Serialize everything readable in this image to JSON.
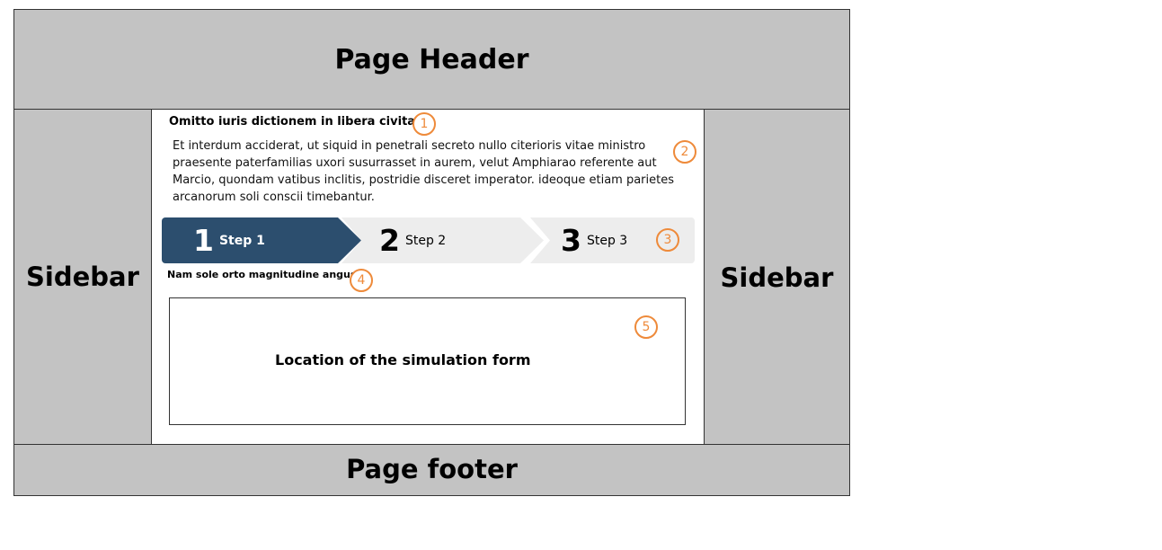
{
  "header": {
    "label": "Page Header"
  },
  "sidebar_left": {
    "label": "Sidebar"
  },
  "sidebar_right": {
    "label": "Sidebar"
  },
  "footer": {
    "label": "Page footer"
  },
  "main": {
    "title": "Omitto iuris dictionem in libera civitate",
    "paragraph": "Et interdum acciderat, ut siquid in penetrali secreto nullo citerioris vitae ministro praesente paterfamilias uxori susurrasset in aurem, velut Amphiarao referente aut Marcio, quondam vatibus inclitis, postridie disceret imperator. ideoque etiam parietes arcanorum soli conscii timebantur.",
    "steps": [
      {
        "number": "1",
        "label": "Step 1",
        "active": true
      },
      {
        "number": "2",
        "label": "Step 2",
        "active": false
      },
      {
        "number": "3",
        "label": "Step 3",
        "active": false
      }
    ],
    "subtitle": "Nam sole orto magnitudine angusti",
    "form_placeholder": "Location of the simulation form"
  },
  "markers": [
    "1",
    "2",
    "3",
    "4",
    "5"
  ],
  "colors": {
    "region_fill": "#c3c3c3",
    "active_step": "#2c4e6e",
    "inactive_step": "#ededed",
    "marker": "#ee8a3a"
  }
}
